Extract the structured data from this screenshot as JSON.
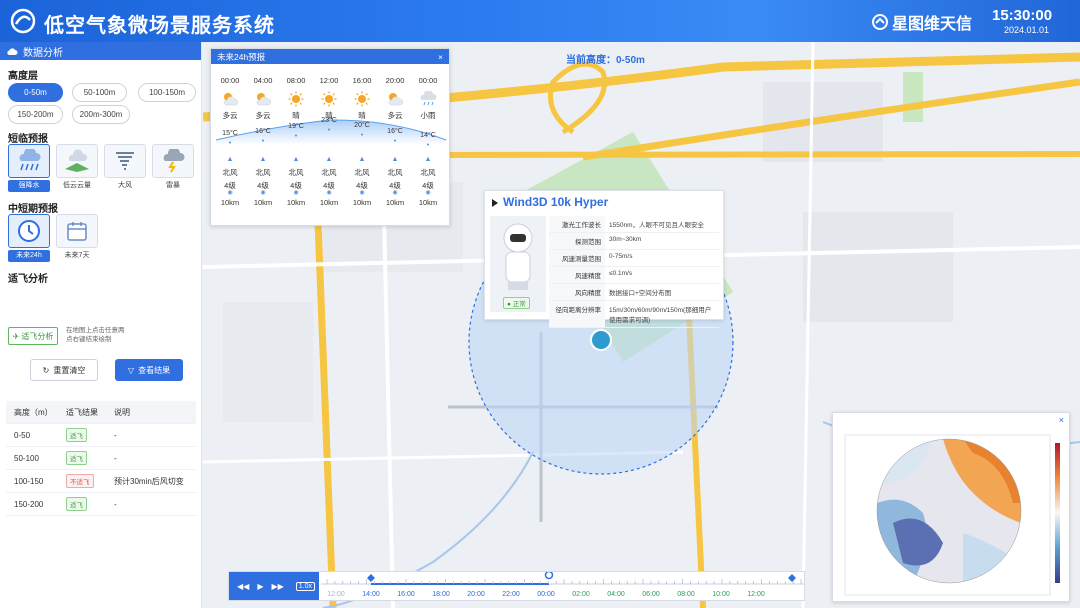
{
  "header": {
    "title": "低空气象微场景服务系统",
    "brand": "星图维天信",
    "time": "15:30:00",
    "date": "2024.01.01"
  },
  "left_panel": {
    "title": "数据分析",
    "altitude": {
      "title": "高度层",
      "options": [
        "0-50m",
        "50-100m",
        "100-150m",
        "150-200m",
        "200m-300m"
      ],
      "selected": "0-50m"
    },
    "short_term": {
      "title": "短临预报",
      "items": [
        "强降水",
        "低云云量",
        "大风",
        "雷暴"
      ],
      "selected": "强降水"
    },
    "mid_term": {
      "title": "中短期预报",
      "items": [
        "未来24h",
        "未来7天"
      ],
      "selected": "未来24h"
    },
    "flyability": {
      "title": "适飞分析",
      "button": "适飞分析",
      "hint": "在地图上点击任意两点右键结束绘制"
    },
    "reset_button": "重置清空",
    "view_button": "查看结果",
    "table": {
      "headers": [
        "高度（m）",
        "适飞结果",
        "说明"
      ],
      "rows": [
        {
          "height": "0-50",
          "result": "适飞",
          "ok": true,
          "note": "-"
        },
        {
          "height": "50-100",
          "result": "适飞",
          "ok": true,
          "note": "-"
        },
        {
          "height": "100-150",
          "result": "不适飞",
          "ok": false,
          "note": "预计30min后风切变"
        },
        {
          "height": "150-200",
          "result": "适飞",
          "ok": true,
          "note": "-"
        }
      ]
    }
  },
  "map": {
    "current_altitude": "当前高度：0-50m"
  },
  "forecast": {
    "title": "未来24h预报",
    "close": "×",
    "slots": [
      {
        "time": "00:00",
        "icon": "partly-cloudy-icon",
        "weather": "多云",
        "temp": "15°C",
        "wind_dir": "北风",
        "level": "4级",
        "vis": "10km"
      },
      {
        "time": "04:00",
        "icon": "partly-cloudy-icon",
        "weather": "多云",
        "temp": "16°C",
        "wind_dir": "北风",
        "level": "4级",
        "vis": "10km"
      },
      {
        "time": "08:00",
        "icon": "sun-icon",
        "weather": "晴",
        "temp": "19°C",
        "wind_dir": "北风",
        "level": "4级",
        "vis": "10km"
      },
      {
        "time": "12:00",
        "icon": "sun-icon",
        "weather": "晴",
        "temp": "23°C",
        "wind_dir": "北风",
        "level": "4级",
        "vis": "10km"
      },
      {
        "time": "16:00",
        "icon": "sun-icon",
        "weather": "晴",
        "temp": "20°C",
        "wind_dir": "北风",
        "level": "4级",
        "vis": "10km"
      },
      {
        "time": "20:00",
        "icon": "partly-cloudy-icon",
        "weather": "多云",
        "temp": "16°C",
        "wind_dir": "北风",
        "level": "4级",
        "vis": "10km"
      },
      {
        "time": "00:00",
        "icon": "light-rain-icon",
        "weather": "小雨",
        "temp": "14°C",
        "wind_dir": "北风",
        "level": "4级",
        "vis": "10km"
      }
    ]
  },
  "lidar_card": {
    "title": "Wind3D 10k Hyper",
    "status": "正常",
    "specs": [
      {
        "key": "激光工作波长",
        "value": "1550nm，人眼不可见且人眼安全"
      },
      {
        "key": "探测范围",
        "value": "30m~30km"
      },
      {
        "key": "风速测量范围",
        "value": "0-75m/s"
      },
      {
        "key": "风速精度",
        "value": "≤0.1m/s"
      },
      {
        "key": "风向精度",
        "value": "数据接口+空间分布图"
      },
      {
        "key": "径向距离分辨率",
        "value": "15m/30m/60m/90m/150m(那细用户使用需求可调)"
      }
    ]
  },
  "heatmap": {
    "close": "×"
  },
  "timeline": {
    "speed": "1.0x",
    "labels": [
      "12:00",
      "14:00",
      "16:00",
      "18:00",
      "20:00",
      "22:00",
      "00:00",
      "02:00",
      "04:00",
      "06:00",
      "08:00",
      "10:00",
      "12:00"
    ]
  },
  "colors": {
    "primary": "#2f6fe0",
    "ok": "#3a9a3a",
    "bad": "#d9534f"
  }
}
